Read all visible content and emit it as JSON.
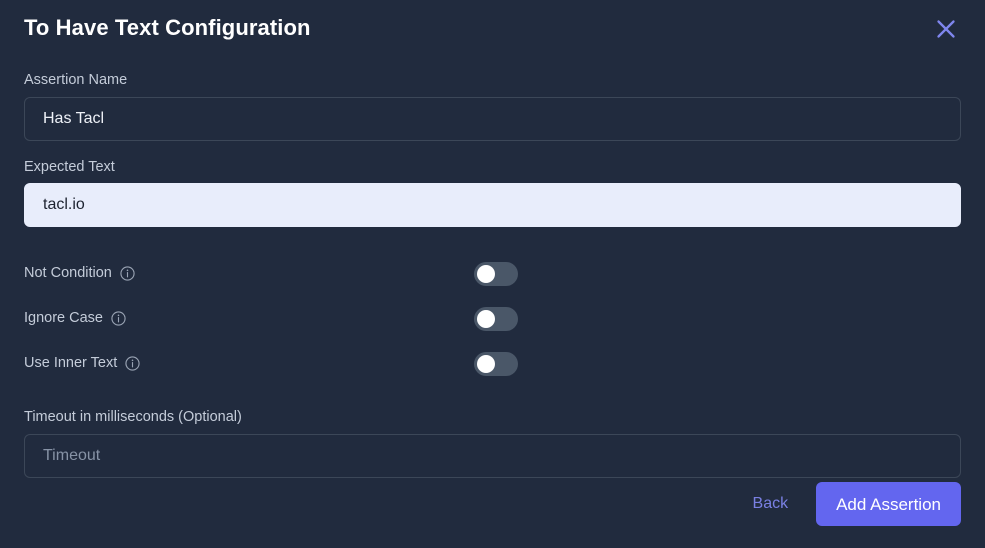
{
  "dialog": {
    "title": "To Have Text Configuration",
    "close_icon": "close-icon"
  },
  "fields": {
    "assertion_name": {
      "label": "Assertion Name",
      "value": "Has Tacl",
      "placeholder": ""
    },
    "expected_text": {
      "label": "Expected Text",
      "value": "tacl.io",
      "placeholder": ""
    },
    "timeout": {
      "label": "Timeout in milliseconds (Optional)",
      "value": "",
      "placeholder": "Timeout"
    }
  },
  "toggles": [
    {
      "label": "Not Condition",
      "state": "off",
      "info_icon": "info-icon"
    },
    {
      "label": "Ignore Case",
      "state": "off",
      "info_icon": "info-icon"
    },
    {
      "label": "Use Inner Text",
      "state": "off",
      "info_icon": "info-icon"
    }
  ],
  "footer": {
    "back_label": "Back",
    "submit_label": "Add Assertion"
  },
  "colors": {
    "background": "#212b3e",
    "accent": "#6366ef",
    "link": "#7a80e3",
    "input_border": "#3c4758",
    "autofill_background": "#e8edfb",
    "toggle_track_off": "#4a5768",
    "toggle_knob": "#ffffff",
    "label_text": "#c4ccd9",
    "title_text": "#ffffff"
  }
}
